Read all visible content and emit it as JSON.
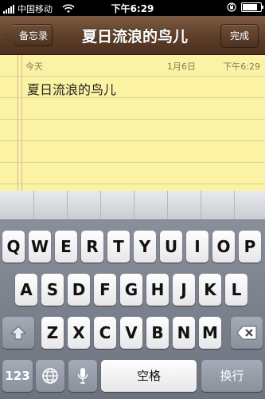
{
  "status_bar": {
    "carrier": "中国移动",
    "time": "下午6:29",
    "icons": [
      "signal-icon",
      "wifi-icon",
      "rotation-lock-icon",
      "battery-icon"
    ],
    "battery_level": 0.9
  },
  "nav": {
    "back_label": "备忘录",
    "title": "夏日流浪的鸟儿",
    "done_label": "完成"
  },
  "note": {
    "day_label": "今天",
    "date": "1月6日",
    "time": "下午6:29",
    "body": "夏日流浪的鸟儿"
  },
  "keyboard": {
    "row1": [
      "Q",
      "W",
      "E",
      "R",
      "T",
      "Y",
      "U",
      "I",
      "O",
      "P"
    ],
    "row2": [
      "A",
      "S",
      "D",
      "F",
      "G",
      "H",
      "J",
      "K",
      "L"
    ],
    "row3": [
      "Z",
      "X",
      "C",
      "V",
      "B",
      "N",
      "M"
    ],
    "numbers_key": "123",
    "space_label": "空格",
    "return_label": "换行",
    "icons": [
      "shift-icon",
      "delete-icon",
      "globe-icon",
      "microphone-icon"
    ]
  },
  "colors": {
    "navbar": "#5b3c27",
    "paper": "#fbf2a3",
    "keyboard_bg": "#7f8590"
  }
}
